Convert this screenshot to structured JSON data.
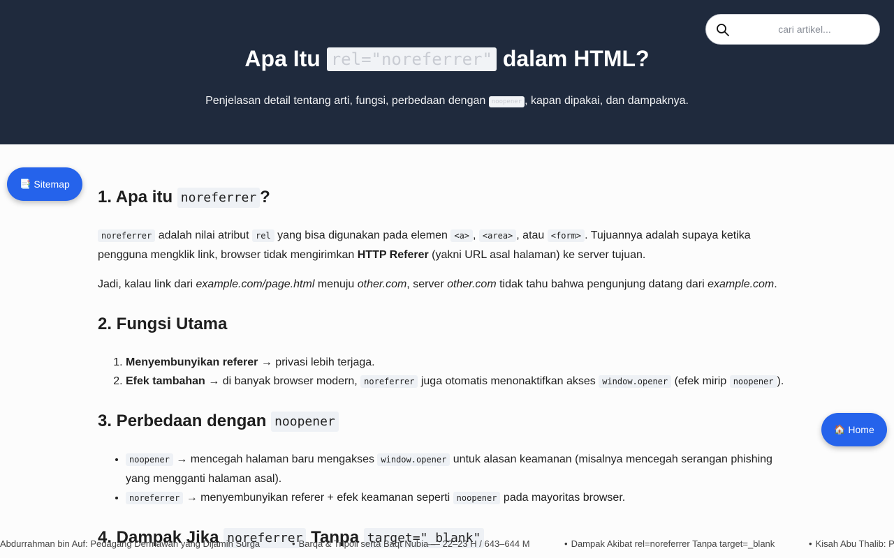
{
  "hero": {
    "title_pre": "Apa Itu",
    "title_code": "rel=\"noreferrer\"",
    "title_post": "dalam HTML?",
    "subtitle_pre": "Penjelasan detail tentang arti, fungsi, perbedaan dengan",
    "subtitle_code": "noopener",
    "subtitle_post": ", kapan dipakai, dan dampaknya."
  },
  "search": {
    "placeholder": "cari artikel...",
    "value": "",
    "icon": "search-icon"
  },
  "buttons": {
    "sitemap": {
      "icon": "📑",
      "label": "Sitemap"
    },
    "home": {
      "icon": "🏠",
      "label": "Home"
    }
  },
  "sections": {
    "s1": {
      "heading_pre": "1. Apa itu",
      "heading_code": "noreferrer",
      "heading_post": "?",
      "p1": {
        "c1": "noreferrer",
        "t1": " adalah nilai atribut ",
        "c2": "rel",
        "t2": " yang bisa digunakan pada elemen ",
        "c3": "<a>",
        "t3": ", ",
        "c4": "<area>",
        "t4": ", atau ",
        "c5": "<form>",
        "t5": ". Tujuannya adalah supaya ketika pengguna mengklik link, browser tidak mengirimkan ",
        "b1": "HTTP Referer",
        "t6": " (yakni URL asal halaman) ke server tujuan."
      },
      "p2": {
        "t1": "Jadi, kalau link dari ",
        "i1": "example.com/page.html",
        "t2": " menuju ",
        "i2": "other.com",
        "t3": ", server ",
        "i3": "other.com",
        "t4": " tidak tahu bahwa pengunjung datang dari ",
        "i4": "example.com",
        "t5": "."
      }
    },
    "s2": {
      "heading": "2. Fungsi Utama",
      "items": [
        {
          "b": "Menyembunyikan referer",
          "t": " → privasi lebih terjaga."
        },
        {
          "b": "Efek tambahan",
          "t1": " → di banyak browser modern, ",
          "c1": "noreferrer",
          "t2": " juga otomatis menonaktifkan akses ",
          "c2": "window.opener",
          "t3": " (efek mirip ",
          "c3": "noopener",
          "t4": ")."
        }
      ]
    },
    "s3": {
      "heading_pre": "3. Perbedaan dengan",
      "heading_code": "noopener",
      "items": [
        {
          "c1": "noopener",
          "t1": " → mencegah halaman baru mengakses ",
          "c2": "window.opener",
          "t2": " untuk alasan keamanan (misalnya mencegah serangan phishing yang mengganti halaman asal)."
        },
        {
          "c1": "noreferrer",
          "t1": " → menyembunyikan referer + efek keamanan seperti ",
          "c2": "noopener",
          "t2": " pada mayoritas browser."
        }
      ]
    },
    "s4": {
      "heading_pre": "4. Dampak Jika",
      "heading_code1": "noreferrer",
      "heading_mid": "Tanpa",
      "heading_code2": "target=\"_blank\""
    }
  },
  "ticker": [
    "Abdurrahman bin Auf: Pedagang Dermawan yang Dijamin Surga",
    "Barqa & Tripoli serta Baqt Nubia — 22–23 H / 643–644 M",
    "Dampak Akibat rel=noreferrer Tanpa target=_blank",
    "Kisah Abu Thalib: Paman Nabi"
  ],
  "colors": {
    "hero_bg": "#1f2a3d",
    "accent": "#2563eb",
    "code_bg": "#eef1f5"
  }
}
